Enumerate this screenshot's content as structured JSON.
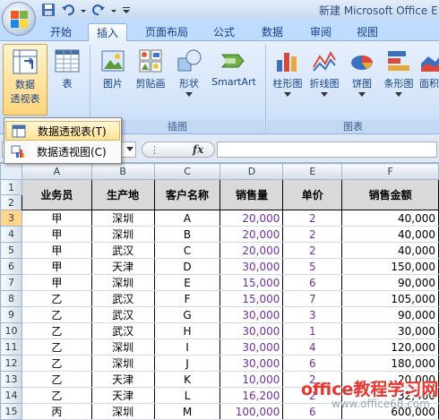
{
  "title_bar": {
    "title": "新建 Microsoft Office E"
  },
  "tabs": [
    {
      "label": "开始"
    },
    {
      "label": "插入"
    },
    {
      "label": "页面布局"
    },
    {
      "label": "公式"
    },
    {
      "label": "数据"
    },
    {
      "label": "审阅"
    },
    {
      "label": "视图"
    }
  ],
  "active_tab": "插入",
  "ribbon": {
    "pivot_button": {
      "label_line1": "数据",
      "label_line2": "透视表"
    },
    "table_button": {
      "label": "表"
    },
    "picture_button": {
      "label": "图片"
    },
    "clipart_button": {
      "label": "剪贴画"
    },
    "shapes_button": {
      "label": "形状"
    },
    "smartart_button": {
      "label": "SmartArt"
    },
    "column_chart_button": {
      "label": "柱形图"
    },
    "line_chart_button": {
      "label": "折线图"
    },
    "pie_chart_button": {
      "label": "饼图"
    },
    "bar_chart_button": {
      "label": "条形图"
    },
    "area_chart_button": {
      "label": "面积"
    },
    "group_illustrations": "插图",
    "group_charts": "图表"
  },
  "dropdown": {
    "items": [
      {
        "label": "数据透视表(T)"
      },
      {
        "label": "数据透视图(C)"
      }
    ]
  },
  "formula_bar": {
    "fx": "fx"
  },
  "columns": [
    "A",
    "B",
    "C",
    "D",
    "E",
    "F"
  ],
  "header_row": [
    "业务员",
    "生产地",
    "客户名称",
    "销售量",
    "单价",
    "销售金额"
  ],
  "rows": [
    {
      "n": "3",
      "a": "甲",
      "b": "深圳",
      "c": "A",
      "d": "20,000",
      "e": "2",
      "f": "40,000"
    },
    {
      "n": "4",
      "a": "甲",
      "b": "深圳",
      "c": "B",
      "d": "20,000",
      "e": "2",
      "f": "40,000"
    },
    {
      "n": "5",
      "a": "甲",
      "b": "武汉",
      "c": "C",
      "d": "20,000",
      "e": "2",
      "f": "40,000"
    },
    {
      "n": "6",
      "a": "甲",
      "b": "天津",
      "c": "D",
      "d": "30,000",
      "e": "5",
      "f": "150,000"
    },
    {
      "n": "7",
      "a": "甲",
      "b": "深圳",
      "c": "E",
      "d": "15,000",
      "e": "6",
      "f": "90,000"
    },
    {
      "n": "8",
      "a": "乙",
      "b": "武汉",
      "c": "F",
      "d": "15,000",
      "e": "7",
      "f": "105,000"
    },
    {
      "n": "9",
      "a": "乙",
      "b": "武汉",
      "c": "G",
      "d": "30,000",
      "e": "3",
      "f": "90,000"
    },
    {
      "n": "10",
      "a": "乙",
      "b": "武汉",
      "c": "H",
      "d": "30,000",
      "e": "1",
      "f": "30,000"
    },
    {
      "n": "11",
      "a": "乙",
      "b": "深圳",
      "c": "I",
      "d": "30,000",
      "e": "4",
      "f": "120,000"
    },
    {
      "n": "12",
      "a": "乙",
      "b": "深圳",
      "c": "J",
      "d": "30,000",
      "e": "6",
      "f": "180,000"
    },
    {
      "n": "13",
      "a": "乙",
      "b": "天津",
      "c": "K",
      "d": "10,000",
      "e": "2",
      "f": "20,000"
    },
    {
      "n": "14",
      "a": "乙",
      "b": "天津",
      "c": "L",
      "d": "16,200",
      "e": "2",
      "f": "32,400"
    },
    {
      "n": "15",
      "a": "丙",
      "b": "深圳",
      "c": "M",
      "d": "100,000",
      "e": "6",
      "f": "600,000"
    }
  ],
  "watermark": {
    "main": "office教程学习网",
    "sub": "www.office68.com"
  }
}
